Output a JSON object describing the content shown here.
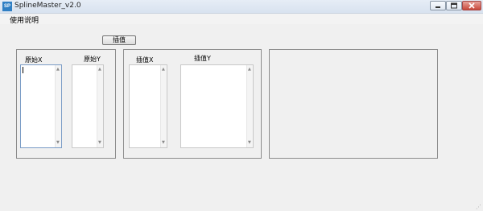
{
  "window": {
    "icon_text": "SP",
    "title": "SplineMaster_v2.0"
  },
  "menu": {
    "items": [
      {
        "label": "使用说明"
      }
    ]
  },
  "toolbar": {
    "interpolate_label": "插值"
  },
  "original_group": {
    "x_label": "原始X",
    "y_label": "原始Y",
    "x_value": "",
    "y_value": ""
  },
  "interp_group": {
    "x_label": "插值X",
    "y_label": "插值Y",
    "x_value": "",
    "y_value": ""
  },
  "icons": [
    "minimize-icon",
    "maximize-icon",
    "close-icon",
    "scroll-up-icon",
    "scroll-down-icon",
    "resize-grip-icon"
  ],
  "colors": {
    "titlebar": "#dfe7f1",
    "close": "#c8473a",
    "window_bg": "#f0f0f0"
  }
}
